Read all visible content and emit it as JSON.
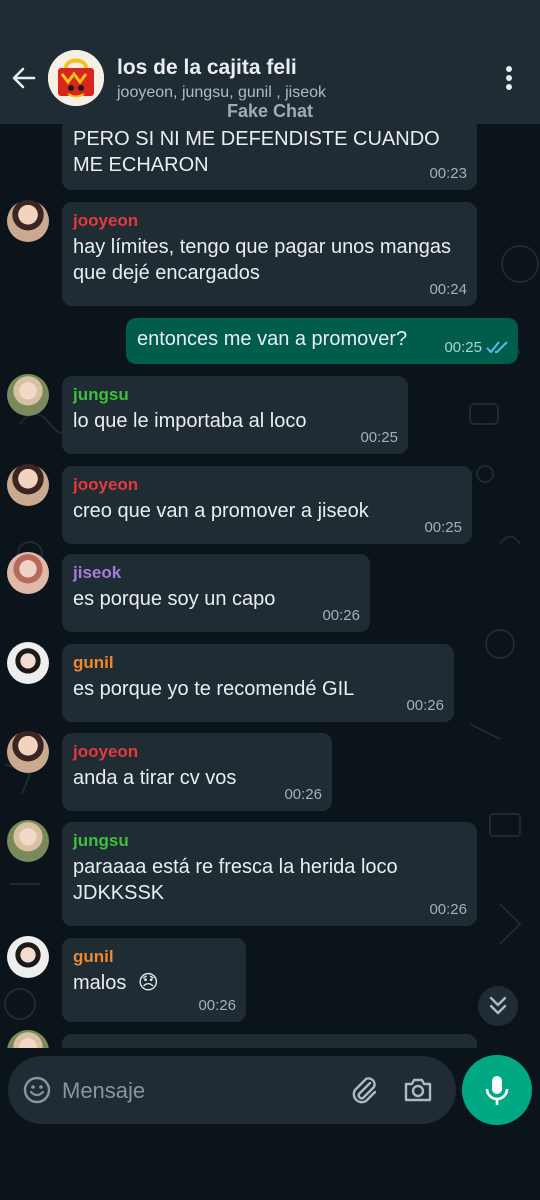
{
  "header": {
    "title": "los de la cajita feli",
    "members": "jooyeon, jungsu, gunil , jiseok",
    "watermark": "Fake Chat",
    "back_icon": "arrow-left-icon",
    "menu_icon": "more-vertical-icon"
  },
  "colors": {
    "background": "#0b141a",
    "bubble_in": "#1f2c34",
    "bubble_out": "#005c4b",
    "accent": "#00a884",
    "read_ticks": "#53bdeb",
    "jooyeon": "#e5393a",
    "jungsu": "#3fbf3f",
    "jiseok": "#a67be0",
    "gunil": "#f0882e"
  },
  "messages": [
    {
      "sender": "",
      "text": "PERO SI NI ME DEFENDISTE CUANDO ME ECHARON",
      "time": "00:23"
    },
    {
      "sender": "jooyeon",
      "text": "hay límites, tengo que pagar unos mangas que dejé encargados",
      "time": "00:24"
    },
    {
      "sender": "",
      "text": "entonces me van a promover?",
      "time": "00:25",
      "outgoing": true
    },
    {
      "sender": "jungsu",
      "text": "lo que le importaba al loco",
      "time": "00:25"
    },
    {
      "sender": "jooyeon",
      "text": "creo que van a promover a jiseok",
      "time": "00:25"
    },
    {
      "sender": "jiseok",
      "text": "es porque soy un capo",
      "time": "00:26"
    },
    {
      "sender": "gunil",
      "text": "es porque yo te recomendé GIL",
      "time": "00:26"
    },
    {
      "sender": "jooyeon",
      "text": "anda a tirar cv vos",
      "time": "00:26"
    },
    {
      "sender": "jungsu",
      "text": "paraaaa está re fresca la herida loco JDKKSSK",
      "time": "00:26"
    },
    {
      "sender": "gunil",
      "text": "malos",
      "emoji": "😞",
      "time": "00:26"
    }
  ],
  "composer": {
    "placeholder": "Mensaje",
    "emoji_icon": "smiley-icon",
    "attach_icon": "paperclip-icon",
    "camera_icon": "camera-icon",
    "mic_icon": "microphone-icon",
    "scroll_icon": "double-chevron-down-icon"
  }
}
